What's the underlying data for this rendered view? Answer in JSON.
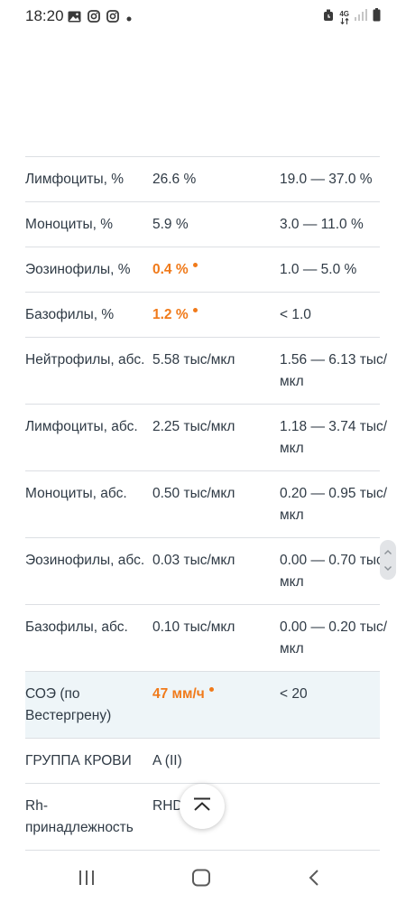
{
  "status_bar": {
    "time": "18:20",
    "left_icons": [
      "image-icon",
      "instagram-icon",
      "instagram-icon",
      "dot-icon"
    ],
    "network": "4G",
    "right_icons": [
      "alarm-icon",
      "network-4g-icon",
      "signal-icon",
      "battery-icon"
    ]
  },
  "table": {
    "rows": [
      {
        "name": "Лимфоциты, %",
        "value": "26.6 %",
        "abnormal": false,
        "ref": "19.0 — 37.0 %"
      },
      {
        "name": "Моноциты, %",
        "value": "5.9 %",
        "abnormal": false,
        "ref": "3.0 — 11.0 %"
      },
      {
        "name": "Эозинофилы, %",
        "value": "0.4 %",
        "abnormal": true,
        "ref": "1.0 — 5.0 %"
      },
      {
        "name": "Базофилы, %",
        "value": "1.2 %",
        "abnormal": true,
        "ref": "< 1.0"
      },
      {
        "name": "Нейтрофилы, абс.",
        "value": "5.58 тыс/мкл",
        "abnormal": false,
        "ref": "1.56 — 6.13 тыс/",
        "ref2": "мкл"
      },
      {
        "name": "Лимфоциты, абс.",
        "value": "2.25 тыс/мкл",
        "abnormal": false,
        "ref": "1.18 — 3.74 тыс/",
        "ref2": "мкл"
      },
      {
        "name": "Моноциты, абс.",
        "value": "0.50 тыс/мкл",
        "abnormal": false,
        "ref": "0.20 — 0.95 тыс/",
        "ref2": "мкл"
      },
      {
        "name": "Эозинофилы, абс.",
        "value": "0.03 тыс/мкл",
        "abnormal": false,
        "ref": "0.00 — 0.70 тыс/",
        "ref2": "мкл"
      },
      {
        "name": "Базофилы, абс.",
        "value": "0.10 тыс/мкл",
        "abnormal": false,
        "ref": "0.00 — 0.20 тыс/",
        "ref2": "мкл"
      },
      {
        "name": "СОЭ (по",
        "name2": "Вестергрену)",
        "value": "47 мм/ч",
        "abnormal": true,
        "ref": "< 20",
        "highlight": true
      },
      {
        "name": "ГРУППА КРОВИ",
        "value": "A (II)",
        "abnormal": false,
        "ref": ""
      },
      {
        "name": "Rh-",
        "name2": "принадлежность",
        "value": "RHD+",
        "abnormal": false,
        "ref": ""
      }
    ]
  },
  "colors": {
    "abnormal": "#f07a1a",
    "divider": "#dcdfe3",
    "highlight_row": "#eef5f8",
    "text": "#2f3a45"
  },
  "controls": {
    "scroll_top_icon": "chevron-up-icon",
    "scroll_handle_icons": [
      "chevron-up-icon",
      "chevron-down-icon"
    ]
  },
  "nav_bar": {
    "buttons": [
      "recent-apps-icon",
      "home-icon",
      "back-icon"
    ]
  }
}
